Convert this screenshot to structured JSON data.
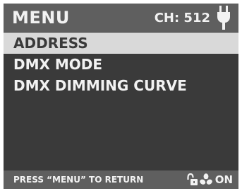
{
  "header": {
    "title": "MENU",
    "channel": "CH: 512",
    "icon": "plug-icon"
  },
  "menu": {
    "items": [
      {
        "label": "ADDRESS",
        "selected": true
      },
      {
        "label": "DMX MODE",
        "selected": false
      },
      {
        "label": "DMX DIMMING CURVE",
        "selected": false
      }
    ]
  },
  "footer": {
    "hint": "PRESS “MENU” TO RETURN",
    "lock_icon": "unlock-icon",
    "fan_icon": "fan-icon",
    "fan_status": "ON"
  },
  "colors": {
    "screen_background": "#3a3a3a",
    "bar_background": "#5f5f5f",
    "selected_row": "#d9d9d9",
    "text": "#f2f2f2"
  }
}
